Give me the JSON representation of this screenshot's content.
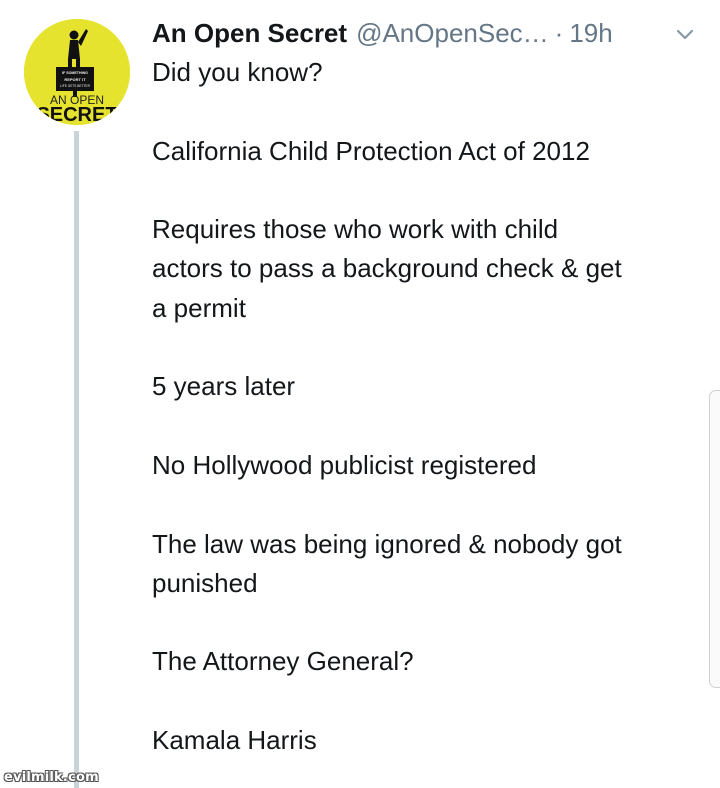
{
  "tweet": {
    "author_name": "An Open Secret",
    "handle": "@AnOpenSec…",
    "separator": "·",
    "time": "19h",
    "avatar": {
      "line1": "AN OPEN",
      "line2": "SECRET",
      "sign_text_1": "IF SOMETHING",
      "sign_text_2": "REPORT IT",
      "sign_text_3": "LIFE GETS BETTER",
      "background_color": "#e6e32f"
    },
    "menu_icon": "chevron-down-icon",
    "lines": [
      "Did you know?",
      "",
      "California Child Protection Act of 2012",
      "",
      "Requires those who work with child",
      "actors to pass a background check & get",
      "a permit",
      "",
      "5 years later",
      "",
      "No Hollywood publicist registered",
      "",
      "The law was being ignored & nobody got",
      "punished",
      "",
      "The Attorney General?",
      "",
      "Kamala Harris"
    ]
  },
  "watermark": "evilmilk.com",
  "colors": {
    "text": "#14171a",
    "secondary": "#657786",
    "thread_line": "#c8d3da"
  }
}
